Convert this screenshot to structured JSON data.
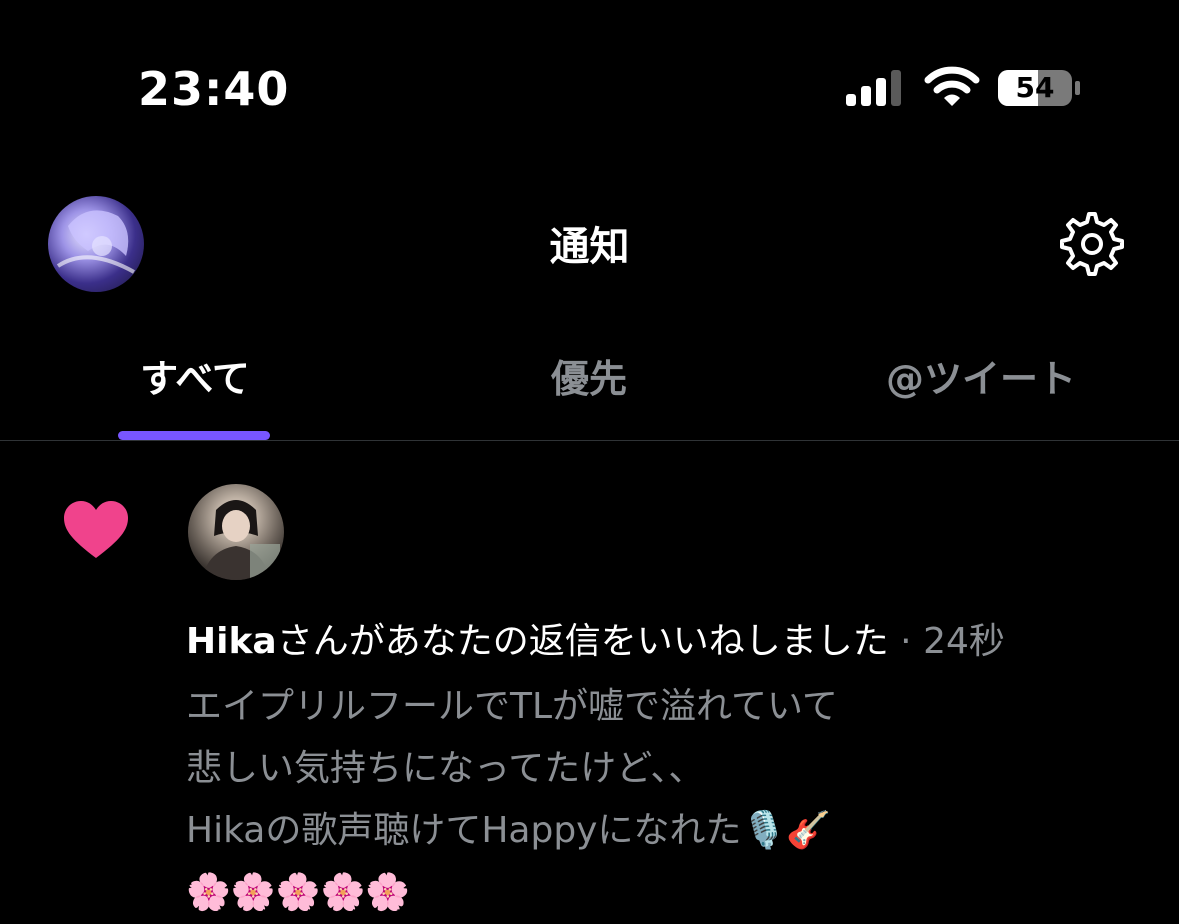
{
  "status_bar": {
    "time": "23:40",
    "battery": "54"
  },
  "header": {
    "title": "通知"
  },
  "tabs": [
    {
      "label": "すべて",
      "active": true
    },
    {
      "label": "優先",
      "active": false
    },
    {
      "label": "@ツイート",
      "active": false
    }
  ],
  "notification": {
    "icon": "heart-icon",
    "icon_color": "#f0438c",
    "user": "Hika",
    "action": "さんがあなたの返信をいいねしました",
    "separator": " · ",
    "time": "24秒",
    "tweet_lines": [
      "エイプリルフールでTLが嘘で溢れていて",
      "悲しい気持ちになってたけど、、",
      "Hikaの歌声聴けてHappyになれた🎙️🎸",
      "🌸🌸🌸🌸🌸"
    ]
  },
  "colors": {
    "accent": "#7856ff",
    "like": "#f0438c",
    "background": "#000000"
  }
}
